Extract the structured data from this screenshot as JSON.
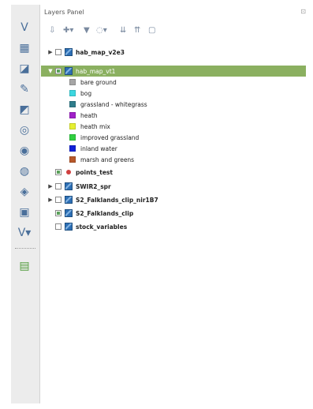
{
  "panel": {
    "title": "Layers Panel",
    "close_glyph": "⊡",
    "toolbar": [
      {
        "name": "open-layer-styling-icon",
        "glyph": "⇩"
      },
      {
        "name": "add-group-icon",
        "glyph": "✚▾"
      },
      {
        "name": "filter-legend-icon",
        "glyph": "▼"
      },
      {
        "name": "expression-filter-icon",
        "glyph": "◌▾"
      },
      {
        "name": "expand-all-icon",
        "glyph": "⇊"
      },
      {
        "name": "collapse-all-icon",
        "glyph": "⇈"
      },
      {
        "name": "remove-layer-icon",
        "glyph": "▢"
      }
    ]
  },
  "toolbar": {
    "icons": [
      "add-vector-layer-icon",
      "add-raster-layer-icon",
      "add-mesh-layer-icon",
      "add-delimited-text-icon",
      "add-spatialite-icon",
      "add-virtual-layer-icon",
      "add-wms-icon",
      "add-wfs-icon",
      "add-wcs-icon",
      "add-xyz-icon",
      "add-vector-tile-icon",
      "new-layer-icon"
    ]
  },
  "layers": [
    {
      "name": "hab_map_v2e3",
      "checked": false,
      "expanded": false,
      "kind": "raster",
      "bold": true
    },
    {
      "name": "hab_map_vt1",
      "checked": true,
      "expanded": true,
      "kind": "raster",
      "bold": false,
      "selected": true
    },
    {
      "name": "points_test",
      "checked": true,
      "expanded": false,
      "kind": "point",
      "bold": true
    },
    {
      "name": "SWIR2_spr",
      "checked": false,
      "expanded": false,
      "kind": "raster",
      "bold": true
    },
    {
      "name": "S2_Falklands_clip_nir1B7",
      "checked": false,
      "expanded": false,
      "kind": "raster",
      "bold": true
    },
    {
      "name": "S2_Falklands_clip",
      "checked": true,
      "expanded": false,
      "kind": "raster",
      "bold": true
    },
    {
      "name": "stock_variables",
      "checked": false,
      "expanded": false,
      "kind": "raster",
      "bold": true
    }
  ],
  "legend": [
    {
      "label": "bare ground",
      "color": "#a6a6a6"
    },
    {
      "label": "bog",
      "color": "#3cd7e0"
    },
    {
      "label": "grassland - whitegrass",
      "color": "#2f7d8c"
    },
    {
      "label": "heath",
      "color": "#a020c8"
    },
    {
      "label": "heath mix",
      "color": "#e6f032"
    },
    {
      "label": "improved grassland",
      "color": "#30d040"
    },
    {
      "label": "inland water",
      "color": "#1020d8"
    },
    {
      "label": "marsh and greens",
      "color": "#b8582a"
    }
  ]
}
